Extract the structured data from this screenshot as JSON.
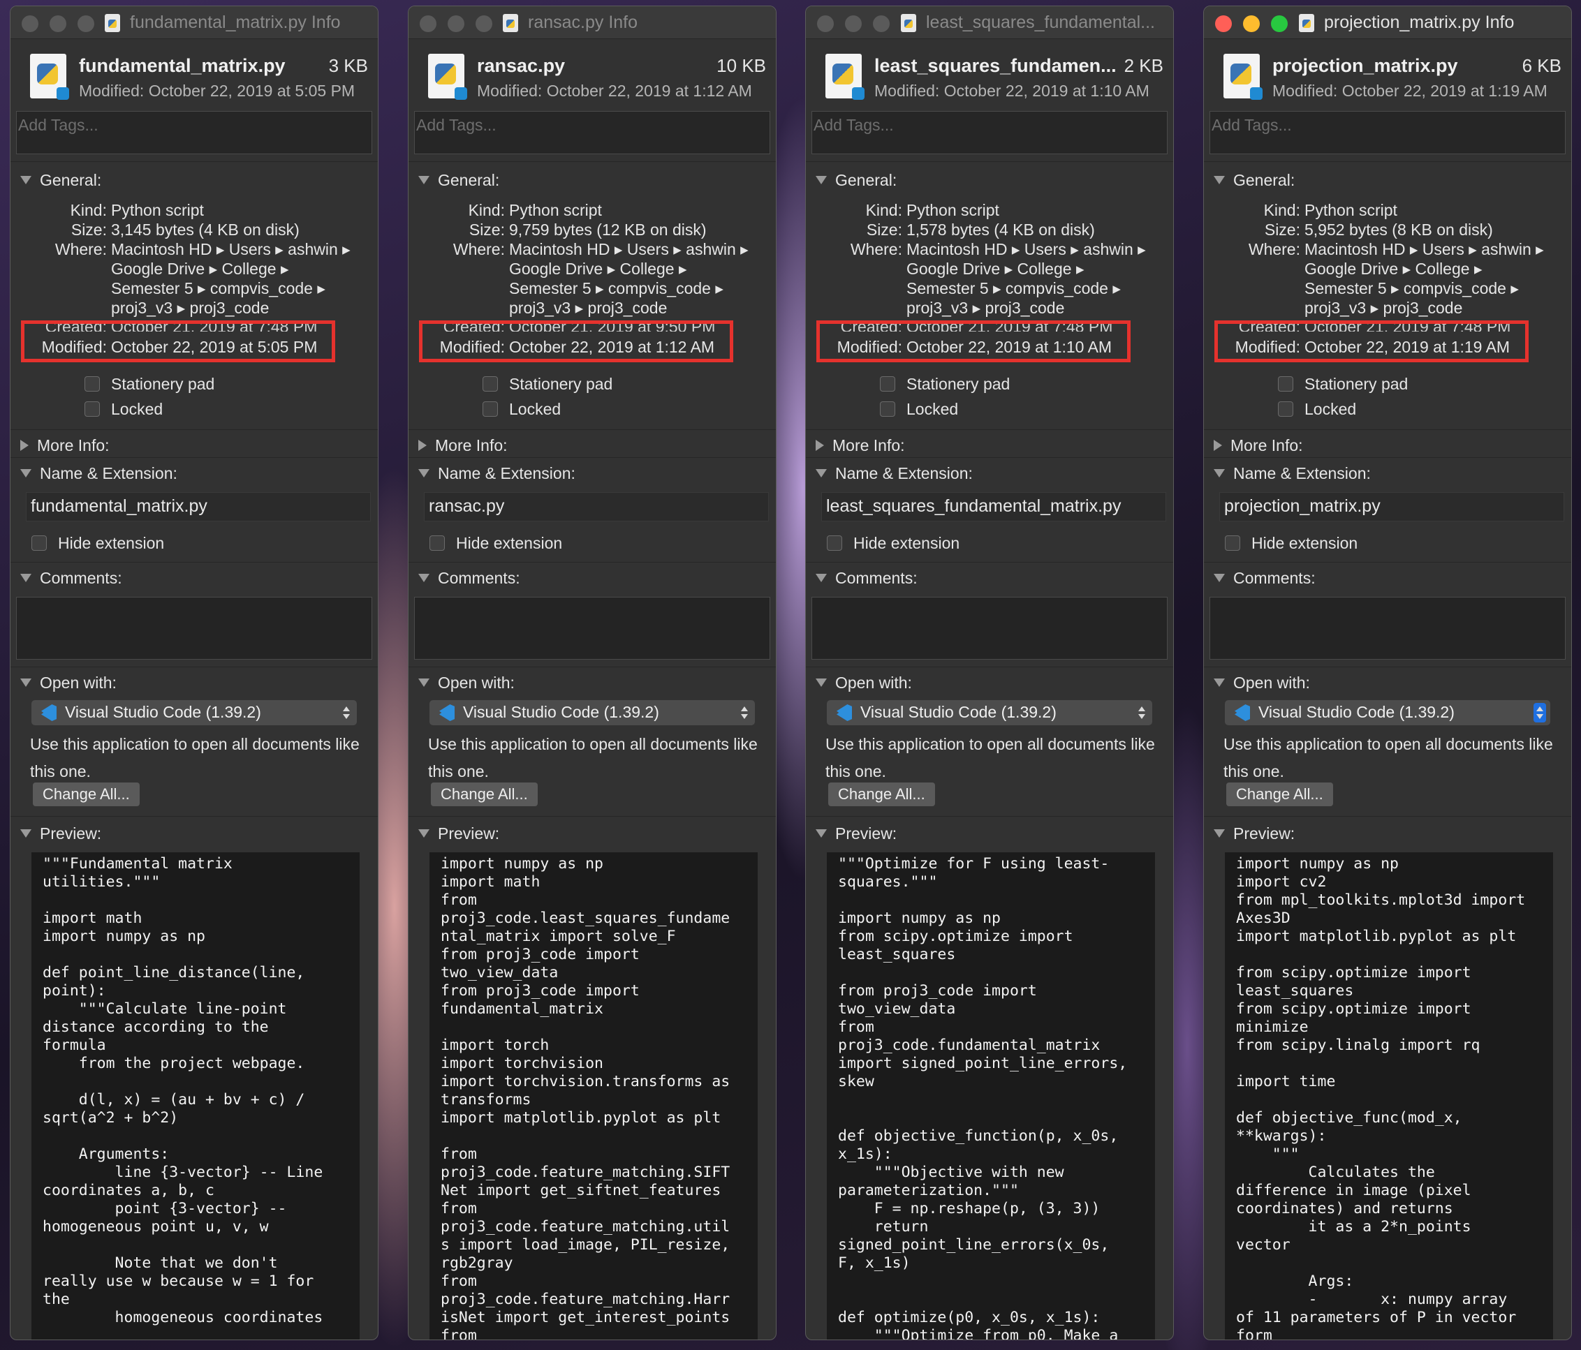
{
  "windows": [
    {
      "title": "fundamental_matrix.py Info",
      "filename": "fundamental_matrix.py",
      "size": "3 KB",
      "modified_header": "Modified: October 22, 2019 at 5:05 PM",
      "tags_placeholder": "Add Tags...",
      "general_label": "General:",
      "kind_label": "Kind:",
      "kind": "Python script",
      "size_label": "Size:",
      "size_detail": "3,145 bytes (4 KB on disk)",
      "where_label": "Where:",
      "where_lines": [
        "Macintosh HD ▸ Users ▸ ashwin ▸",
        "Google Drive ▸ College ▸",
        "Semester 5 ▸ compvis_code ▸",
        "proj3_v3 ▸ proj3_code"
      ],
      "created_label": "Created:",
      "created": "October 21, 2019 at 7:48 PM",
      "modified_label": "Modified:",
      "modified": "October 22, 2019 at 5:05 PM",
      "stationery_label": "Stationery pad",
      "locked_label": "Locked",
      "more_info_label": "More Info:",
      "name_ext_label": "Name & Extension:",
      "name_value": "fundamental_matrix.py",
      "hide_ext_label": "Hide extension",
      "comments_label": "Comments:",
      "open_with_label": "Open with:",
      "app": "Visual Studio Code (1.39.2)",
      "use_app_text": "Use this application to open all documents like this one.",
      "change_all": "Change All...",
      "preview_label": "Preview:",
      "preview_code": "\"\"\"Fundamental matrix\nutilities.\"\"\"\n\nimport math\nimport numpy as np\n\ndef point_line_distance(line,\npoint):\n    \"\"\"Calculate line-point\ndistance according to the\nformula\n    from the project webpage.\n\n    d(l, x) = (au + bv + c) /\nsqrt(a^2 + b^2)\n\n    Arguments:\n        line {3-vector} -- Line\ncoordinates a, b, c\n        point {3-vector} --\nhomogeneous point u, v, w\n\n        Note that we don't\nreally use w because w = 1 for\nthe\n        homogeneous coordinates"
    },
    {
      "title": "ransac.py Info",
      "filename": "ransac.py",
      "size": "10 KB",
      "modified_header": "Modified: October 22, 2019 at 1:12 AM",
      "tags_placeholder": "Add Tags...",
      "general_label": "General:",
      "kind_label": "Kind:",
      "kind": "Python script",
      "size_label": "Size:",
      "size_detail": "9,759 bytes (12 KB on disk)",
      "where_label": "Where:",
      "where_lines": [
        "Macintosh HD ▸ Users ▸ ashwin ▸",
        "Google Drive ▸ College ▸",
        "Semester 5 ▸ compvis_code ▸",
        "proj3_v3 ▸ proj3_code"
      ],
      "created_label": "Created:",
      "created": "October 21, 2019 at 9:50 PM",
      "modified_label": "Modified:",
      "modified": "October 22, 2019 at 1:12 AM",
      "stationery_label": "Stationery pad",
      "locked_label": "Locked",
      "more_info_label": "More Info:",
      "name_ext_label": "Name & Extension:",
      "name_value": "ransac.py",
      "hide_ext_label": "Hide extension",
      "comments_label": "Comments:",
      "open_with_label": "Open with:",
      "app": "Visual Studio Code (1.39.2)",
      "use_app_text": "Use this application to open all documents like this one.",
      "change_all": "Change All...",
      "preview_label": "Preview:",
      "preview_code": "import numpy as np\nimport math\nfrom\nproj3_code.least_squares_fundame\nntal_matrix import solve_F\nfrom proj3_code import\ntwo_view_data\nfrom proj3_code import\nfundamental_matrix\n\nimport torch\nimport torchvision\nimport torchvision.transforms as\ntransforms\nimport matplotlib.pyplot as plt\n\nfrom\nproj3_code.feature_matching.SIFT\nNet import get_siftnet_features\nfrom\nproj3_code.feature_matching.util\ns import load_image, PIL_resize,\nrgb2gray\nfrom\nproj3_code.feature_matching.Harr\nisNet import get_interest_points\nfrom"
    },
    {
      "title": "least_squares_fundamental...",
      "filename": "least_squares_fundamen...",
      "size": "2 KB",
      "modified_header": "Modified: October 22, 2019 at 1:10 AM",
      "tags_placeholder": "Add Tags...",
      "general_label": "General:",
      "kind_label": "Kind:",
      "kind": "Python script",
      "size_label": "Size:",
      "size_detail": "1,578 bytes (4 KB on disk)",
      "where_label": "Where:",
      "where_lines": [
        "Macintosh HD ▸ Users ▸ ashwin ▸",
        "Google Drive ▸ College ▸",
        "Semester 5 ▸ compvis_code ▸",
        "proj3_v3 ▸ proj3_code"
      ],
      "created_label": "Created:",
      "created": "October 21, 2019 at 7:48 PM",
      "modified_label": "Modified:",
      "modified": "October 22, 2019 at 1:10 AM",
      "stationery_label": "Stationery pad",
      "locked_label": "Locked",
      "more_info_label": "More Info:",
      "name_ext_label": "Name & Extension:",
      "name_value": "least_squares_fundamental_matrix.py",
      "hide_ext_label": "Hide extension",
      "comments_label": "Comments:",
      "open_with_label": "Open with:",
      "app": "Visual Studio Code (1.39.2)",
      "use_app_text": "Use this application to open all documents like this one.",
      "change_all": "Change All...",
      "preview_label": "Preview:",
      "preview_code": "\"\"\"Optimize for F using least-\nsquares.\"\"\"\n\nimport numpy as np\nfrom scipy.optimize import\nleast_squares\n\nfrom proj3_code import\ntwo_view_data\nfrom\nproj3_code.fundamental_matrix\nimport signed_point_line_errors,\nskew\n\n\ndef objective_function(p, x_0s,\nx_1s):\n    \"\"\"Objective with new\nparameterization.\"\"\"\n    F = np.reshape(p, (3, 3))\n    return\nsigned_point_line_errors(x_0s,\nF, x_1s)\n\n\ndef optimize(p0, x_0s, x_1s):\n    \"\"\"Optimize from p0. Make a"
    },
    {
      "title": "projection_matrix.py Info",
      "filename": "projection_matrix.py",
      "size": "6 KB",
      "modified_header": "Modified: October 22, 2019 at 1:19 AM",
      "tags_placeholder": "Add Tags...",
      "general_label": "General:",
      "kind_label": "Kind:",
      "kind": "Python script",
      "size_label": "Size:",
      "size_detail": "5,952 bytes (8 KB on disk)",
      "where_label": "Where:",
      "where_lines": [
        "Macintosh HD ▸ Users ▸ ashwin ▸",
        "Google Drive ▸ College ▸",
        "Semester 5 ▸ compvis_code ▸",
        "proj3_v3 ▸ proj3_code"
      ],
      "created_label": "Created:",
      "created": "October 21, 2019 at 7:48 PM",
      "modified_label": "Modified:",
      "modified": "October 22, 2019 at 1:19 AM",
      "stationery_label": "Stationery pad",
      "locked_label": "Locked",
      "more_info_label": "More Info:",
      "name_ext_label": "Name & Extension:",
      "name_value": "projection_matrix.py",
      "hide_ext_label": "Hide extension",
      "comments_label": "Comments:",
      "open_with_label": "Open with:",
      "app": "Visual Studio Code (1.39.2)",
      "use_app_text": "Use this application to open all documents like this one.",
      "change_all": "Change All...",
      "preview_label": "Preview:",
      "preview_code": "import numpy as np\nimport cv2\nfrom mpl_toolkits.mplot3d import\nAxes3D\nimport matplotlib.pyplot as plt\n\nfrom scipy.optimize import\nleast_squares\nfrom scipy.optimize import\nminimize\nfrom scipy.linalg import rq\n\nimport time\n\ndef objective_func(mod_x,\n**kwargs):\n    \"\"\"\n        Calculates the\ndifference in image (pixel\ncoordinates) and returns\n        it as a 2*n_points\nvector\n\n        Args:\n        -       x: numpy array\nof 11 parameters of P in vector\nform"
    }
  ]
}
